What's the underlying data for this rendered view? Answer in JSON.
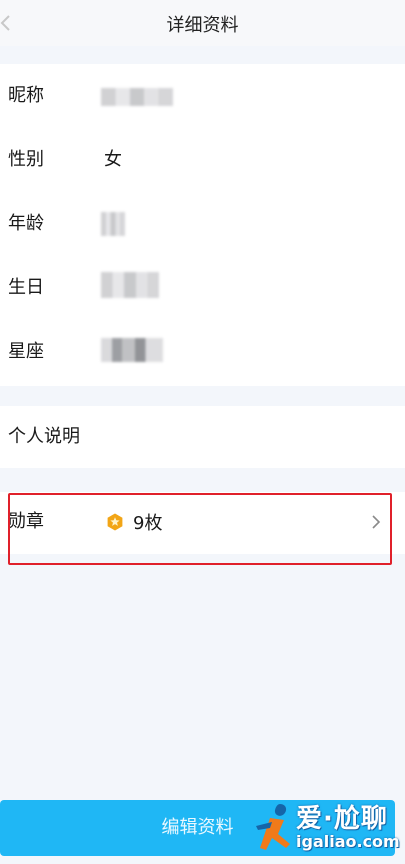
{
  "header": {
    "title": "详细资料",
    "back_icon": "chevron-left-icon"
  },
  "profile": {
    "nickname_label": "昵称",
    "gender_label": "性别",
    "gender_value": "女",
    "age_label": "年龄",
    "birthday_label": "生日",
    "zodiac_label": "星座"
  },
  "description": {
    "label": "个人说明"
  },
  "medal": {
    "label": "勋章",
    "icon": "medal-icon",
    "count": "9枚",
    "arrow_icon": "chevron-right-icon"
  },
  "footer": {
    "edit_button_label": "编辑资料"
  },
  "watermark": {
    "main": "爱·尬聊",
    "site": "igaliao.com"
  },
  "colors": {
    "background": "#f3f6fb",
    "card": "#ffffff",
    "accent_button": "#1fb7f5",
    "highlight_border": "#e0202a",
    "medal_gold": "#f2a516"
  }
}
